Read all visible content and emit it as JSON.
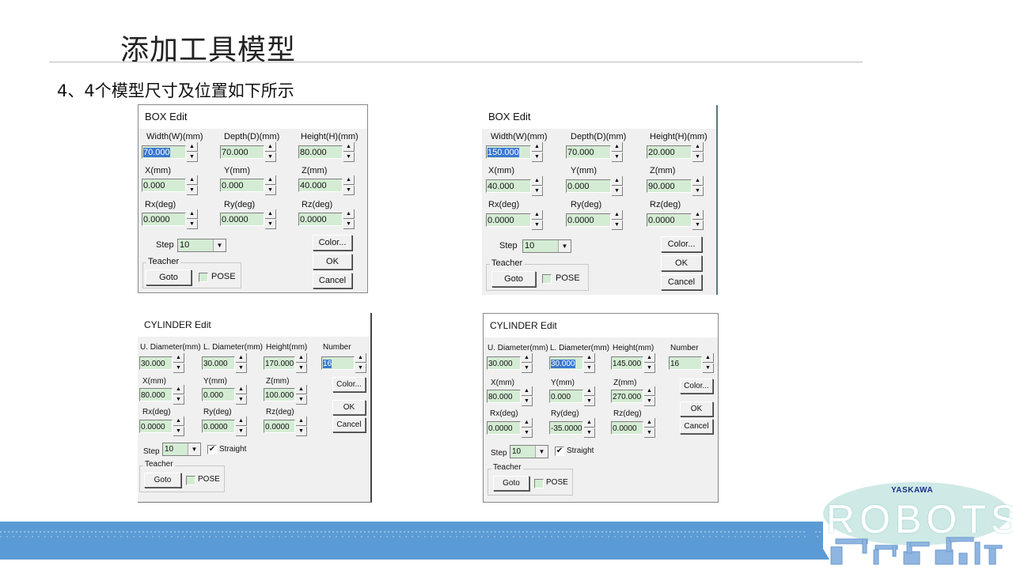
{
  "slide": {
    "title": "添加工具模型",
    "subtitle": "4、4个模型尺寸及位置如下所示"
  },
  "colors": {
    "footer_bar": "#5b9bd5",
    "field_bg": "#d4ecd4",
    "selection": "#3a78d0",
    "dialog_bg": "#f0f0f0"
  },
  "box1": {
    "caption": "BOX Edit",
    "labels": {
      "width": "Width(W)(mm)",
      "depth": "Depth(D)(mm)",
      "height": "Height(H)(mm)",
      "x": "X(mm)",
      "y": "Y(mm)",
      "z": "Z(mm)",
      "rx": "Rx(deg)",
      "ry": "Ry(deg)",
      "rz": "Rz(deg)",
      "step": "Step",
      "teacher": "Teacher",
      "pose": "POSE"
    },
    "values": {
      "width": "70.000",
      "depth": "70.000",
      "height": "80.000",
      "x": "0.000",
      "y": "0.000",
      "z": "40.000",
      "rx": "0.0000",
      "ry": "0.0000",
      "rz": "0.0000",
      "step": "10"
    },
    "buttons": {
      "color": "Color...",
      "ok": "OK",
      "cancel": "Cancel",
      "goto": "Goto"
    },
    "pose_checked": false
  },
  "box2": {
    "caption": "BOX Edit",
    "labels": {
      "width": "Width(W)(mm)",
      "depth": "Depth(D)(mm)",
      "height": "Height(H)(mm)",
      "x": "X(mm)",
      "y": "Y(mm)",
      "z": "Z(mm)",
      "rx": "Rx(deg)",
      "ry": "Ry(deg)",
      "rz": "Rz(deg)",
      "step": "Step",
      "teacher": "Teacher",
      "pose": "POSE"
    },
    "values": {
      "width": "150.000",
      "depth": "70.000",
      "height": "20.000",
      "x": "40.000",
      "y": "0.000",
      "z": "90.000",
      "rx": "0.0000",
      "ry": "0.0000",
      "rz": "0.0000",
      "step": "10"
    },
    "buttons": {
      "color": "Color...",
      "ok": "OK",
      "cancel": "Cancel",
      "goto": "Goto"
    },
    "pose_checked": false
  },
  "cyl1": {
    "caption": "CYLINDER Edit",
    "labels": {
      "udia": "U. Diameter(mm)",
      "ldia": "L. Diameter(mm)",
      "height": "Height(mm)",
      "number": "Number",
      "x": "X(mm)",
      "y": "Y(mm)",
      "z": "Z(mm)",
      "rx": "Rx(deg)",
      "ry": "Ry(deg)",
      "rz": "Rz(deg)",
      "step": "Step",
      "straight": "Straight",
      "teacher": "Teacher",
      "pose": "POSE"
    },
    "values": {
      "udia": "30.000",
      "ldia": "30.000",
      "height": "170.000",
      "number": "16",
      "x": "80.000",
      "y": "0.000",
      "z": "100.000",
      "rx": "0.0000",
      "ry": "0.0000",
      "rz": "0.0000",
      "step": "10"
    },
    "buttons": {
      "color": "Color...",
      "ok": "OK",
      "cancel": "Cancel",
      "goto": "Goto"
    },
    "straight_checked": true,
    "pose_checked": false
  },
  "cyl2": {
    "caption": "CYLINDER Edit",
    "labels": {
      "udia": "U. Diameter(mm)",
      "ldia": "L. Diameter(mm)",
      "height": "Height(mm)",
      "number": "Number",
      "x": "X(mm)",
      "y": "Y(mm)",
      "z": "Z(mm)",
      "rx": "Rx(deg)",
      "ry": "Ry(deg)",
      "rz": "Rz(deg)",
      "step": "Step",
      "straight": "Straight",
      "teacher": "Teacher",
      "pose": "POSE"
    },
    "values": {
      "udia": "30.000",
      "ldia": "30.000",
      "height": "145.000",
      "number": "16",
      "x": "80.000",
      "y": "0.000",
      "z": "270.000",
      "rx": "0.0000",
      "ry": "-35.0000",
      "rz": "0.0000",
      "step": "10"
    },
    "buttons": {
      "color": "Color...",
      "ok": "OK",
      "cancel": "Cancel",
      "goto": "Goto"
    },
    "straight_checked": true,
    "pose_checked": false
  },
  "logo": {
    "brand": "YASKAWA",
    "wordmark": "ROBOTS"
  },
  "icons": {
    "spin_up": "▲",
    "spin_down": "▼",
    "dropdown": "▼",
    "check": "✔"
  }
}
